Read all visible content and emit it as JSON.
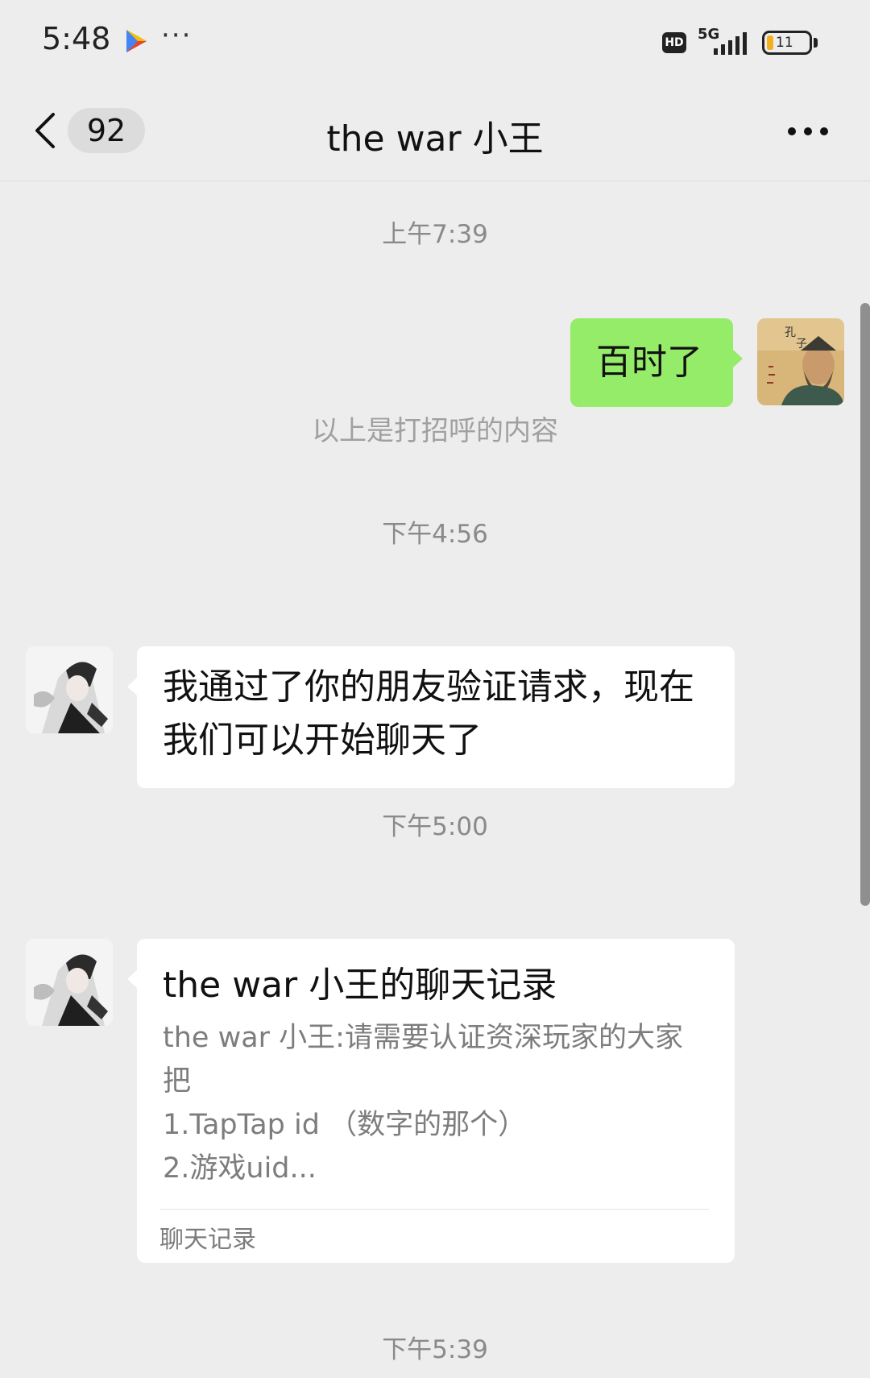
{
  "status_bar": {
    "time": "5:48",
    "dots": "···",
    "hd": "HD",
    "network": "5G",
    "battery": "11"
  },
  "nav": {
    "unread_count": "92",
    "title": "the war 小王"
  },
  "messages": {
    "ts1": "上午7:39",
    "m1_text": "百时了",
    "system_note": "以上是打招呼的内容",
    "ts2": "下午4:56",
    "m2_line1": "我通过了你的朋友验证请求，现在",
    "m2_line2": "我们可以开始聊天了",
    "ts3": "下午5:00",
    "card_title": "the war 小王的聊天记录",
    "card_line1": "the war 小王:请需要认证资深玩家的大家",
    "card_line2": "把",
    "card_line3": "1.TapTap id （数字的那个）",
    "card_line4": "2.游戏uid...",
    "card_footer": "聊天记录",
    "ts4": "下午5:39"
  },
  "colors": {
    "background": "#ededed",
    "outgoing_bubble": "#95ec69",
    "incoming_bubble": "#ffffff",
    "timestamp": "#8a8a8a"
  },
  "icons": [
    "play-store-icon",
    "back-chevron-icon",
    "more-dots-icon",
    "signal-icon",
    "battery-icon",
    "hd-icon"
  ]
}
